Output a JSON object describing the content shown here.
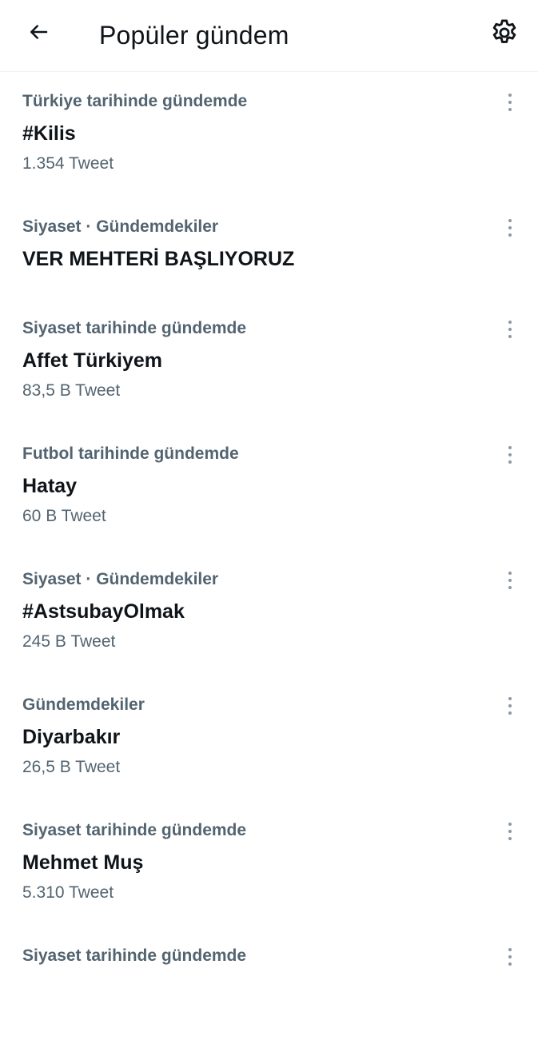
{
  "header": {
    "title": "Popüler gündem",
    "back_icon": "arrow-left-icon",
    "settings_icon": "gear-icon"
  },
  "colors": {
    "primary_text": "#0f1419",
    "secondary_text": "#536471",
    "divider": "#eff3f4"
  },
  "trends": [
    {
      "context": "Türkiye tarihinde gündemde",
      "name": "#Kilis",
      "count": "1.354 Tweet"
    },
    {
      "context": "Siyaset · Gündemdekiler",
      "name": "VER MEHTERİ BAŞLIYORUZ",
      "count": ""
    },
    {
      "context": "Siyaset tarihinde gündemde",
      "name": "Affet Türkiyem",
      "count": "83,5 B Tweet"
    },
    {
      "context": "Futbol tarihinde gündemde",
      "name": "Hatay",
      "count": "60 B Tweet"
    },
    {
      "context": "Siyaset · Gündemdekiler",
      "name": "#AstsubayOlmak",
      "count": "245 B Tweet"
    },
    {
      "context": "Gündemdekiler",
      "name": "Diyarbakır",
      "count": "26,5 B Tweet"
    },
    {
      "context": "Siyaset tarihinde gündemde",
      "name": "Mehmet Muş",
      "count": "5.310 Tweet"
    },
    {
      "context": "Siyaset tarihinde gündemde",
      "name": "",
      "count": ""
    }
  ]
}
